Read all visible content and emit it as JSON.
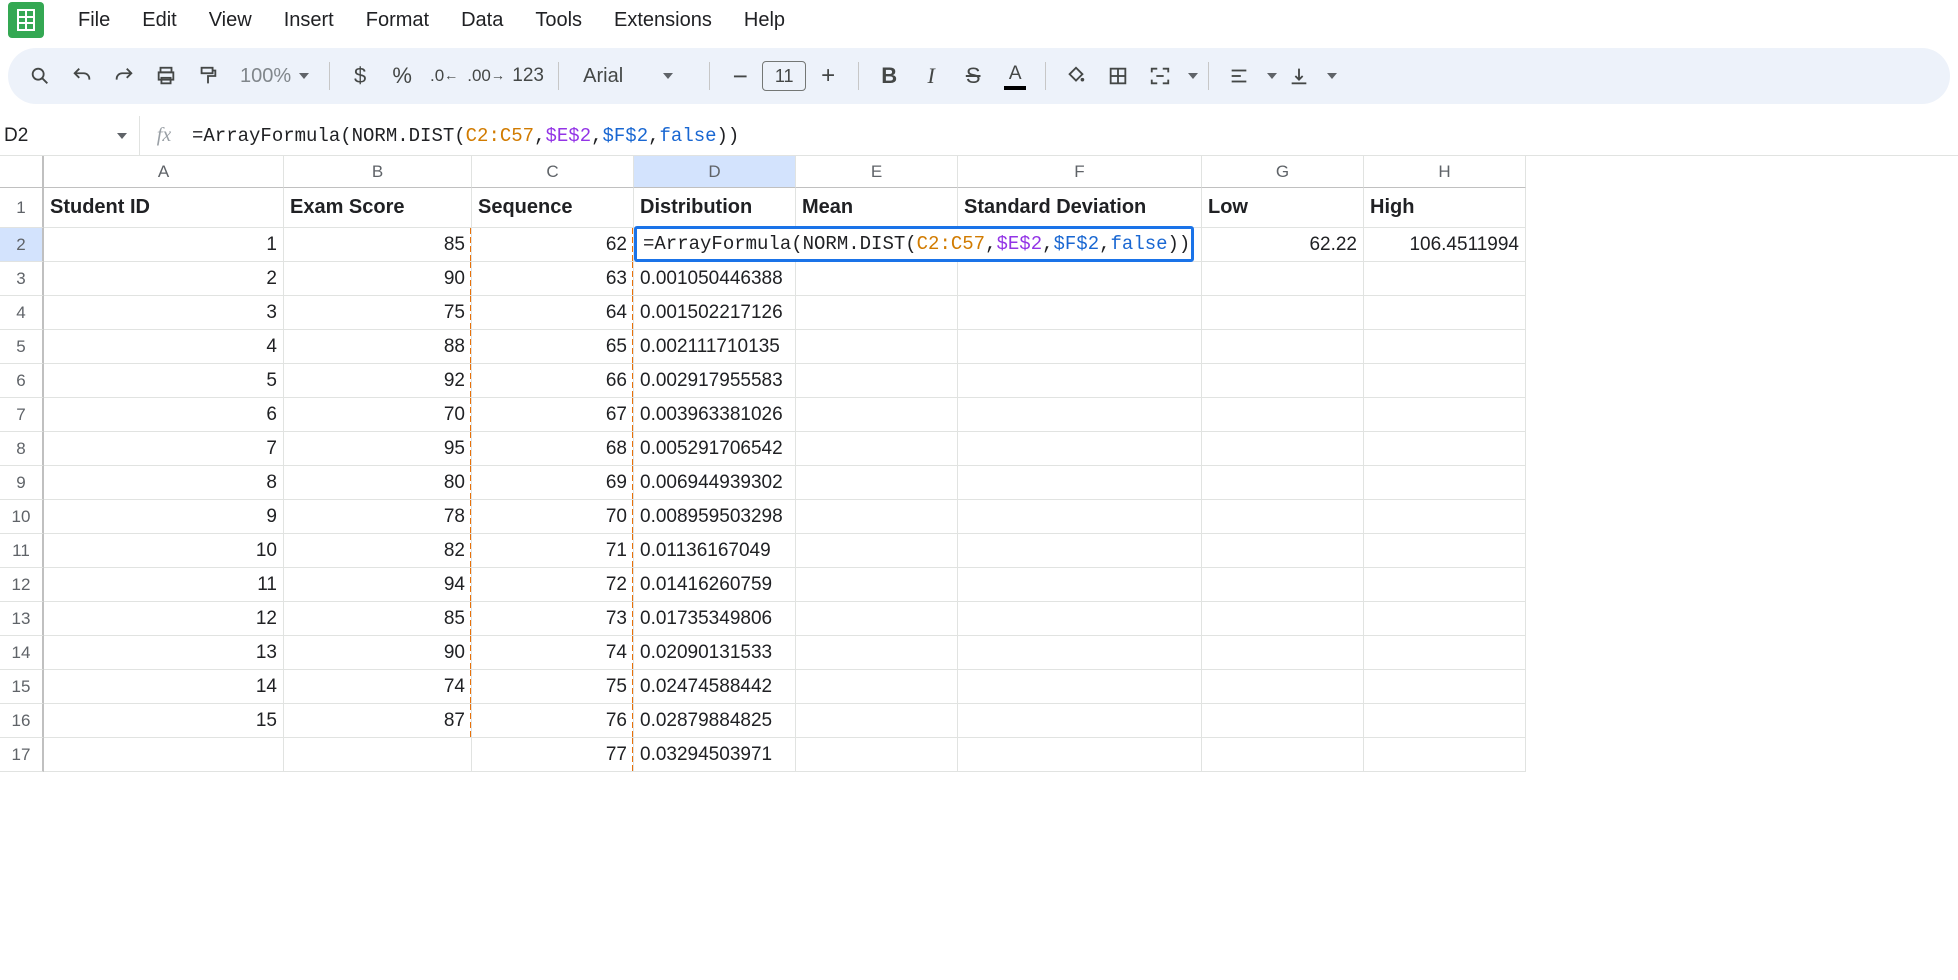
{
  "menu": {
    "file": "File",
    "edit": "Edit",
    "view": "View",
    "insert": "Insert",
    "format": "Format",
    "data": "Data",
    "tools": "Tools",
    "extensions": "Extensions",
    "help": "Help"
  },
  "toolbar": {
    "zoom": "100%",
    "number_format": "123",
    "font_name": "Arial",
    "font_size": "11"
  },
  "namebox": "D2",
  "formula": {
    "prefix": "=ArrayFormula(NORM.DIST(",
    "range": "C2:C57",
    "sep1": ",",
    "ref1": "$E$2",
    "sep2": ",",
    "ref2": "$F$2",
    "sep3": ",",
    "bool": "false",
    "suffix": "))"
  },
  "columns": [
    "A",
    "B",
    "C",
    "D",
    "E",
    "F",
    "G",
    "H"
  ],
  "headers": {
    "a": "Student ID",
    "b": "Exam Score",
    "c": "Sequence",
    "d": "Distribution",
    "e": "Mean",
    "f": "Standard Deviation",
    "g": "Low",
    "h": "High"
  },
  "row2_extra": {
    "g": "62.22",
    "h": "106.4511994"
  },
  "rows": [
    {
      "n": "2",
      "a": "1",
      "b": "85",
      "c": "62",
      "d": ""
    },
    {
      "n": "3",
      "a": "2",
      "b": "90",
      "c": "63",
      "d": "0.001050446388"
    },
    {
      "n": "4",
      "a": "3",
      "b": "75",
      "c": "64",
      "d": "0.001502217126"
    },
    {
      "n": "5",
      "a": "4",
      "b": "88",
      "c": "65",
      "d": "0.002111710135"
    },
    {
      "n": "6",
      "a": "5",
      "b": "92",
      "c": "66",
      "d": "0.002917955583"
    },
    {
      "n": "7",
      "a": "6",
      "b": "70",
      "c": "67",
      "d": "0.003963381026"
    },
    {
      "n": "8",
      "a": "7",
      "b": "95",
      "c": "68",
      "d": "0.005291706542"
    },
    {
      "n": "9",
      "a": "8",
      "b": "80",
      "c": "69",
      "d": "0.006944939302"
    },
    {
      "n": "10",
      "a": "9",
      "b": "78",
      "c": "70",
      "d": "0.008959503298"
    },
    {
      "n": "11",
      "a": "10",
      "b": "82",
      "c": "71",
      "d": "0.01136167049"
    },
    {
      "n": "12",
      "a": "11",
      "b": "94",
      "c": "72",
      "d": "0.01416260759"
    },
    {
      "n": "13",
      "a": "12",
      "b": "85",
      "c": "73",
      "d": "0.01735349806"
    },
    {
      "n": "14",
      "a": "13",
      "b": "90",
      "c": "74",
      "d": "0.02090131533"
    },
    {
      "n": "15",
      "a": "14",
      "b": "74",
      "c": "75",
      "d": "0.02474588442"
    },
    {
      "n": "16",
      "a": "15",
      "b": "87",
      "c": "76",
      "d": "0.02879884825"
    },
    {
      "n": "17",
      "a": "",
      "b": "",
      "c": "77",
      "d": "0.03294503971"
    }
  ]
}
